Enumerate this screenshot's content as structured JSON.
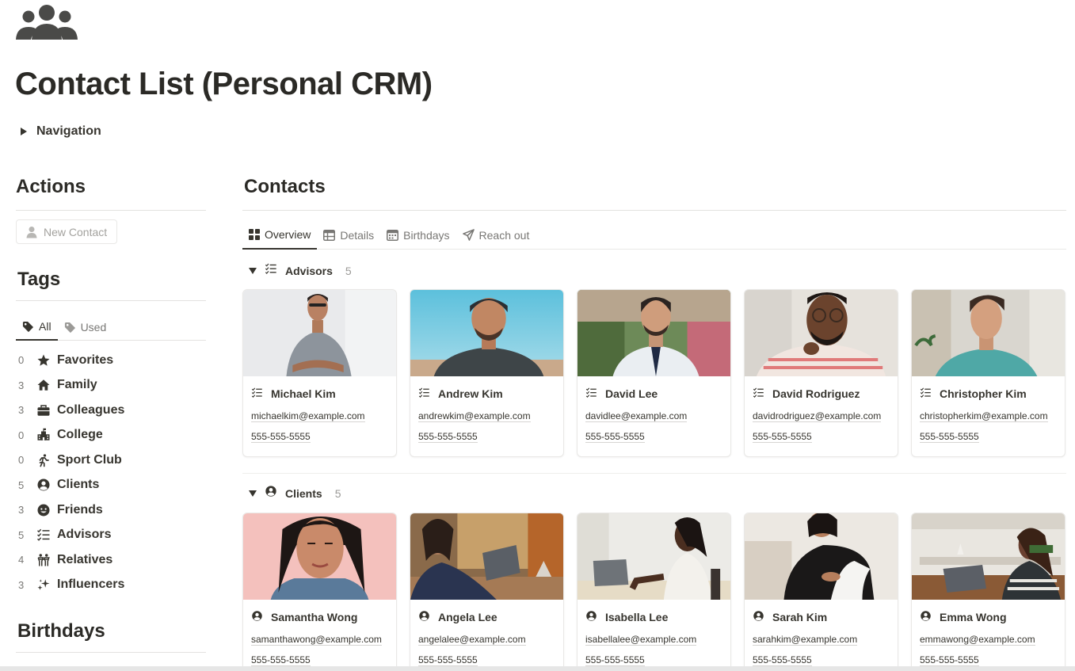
{
  "page": {
    "icon": "people-group-icon",
    "title": "Contact List (Personal CRM)",
    "navigation_toggle": "Navigation"
  },
  "actions": {
    "title": "Actions",
    "new_contact": "New Contact"
  },
  "tags": {
    "title": "Tags",
    "tabs": [
      {
        "label": "All",
        "icon": "tag-icon",
        "active": true
      },
      {
        "label": "Used",
        "icon": "tag-icon",
        "active": false
      }
    ],
    "items": [
      {
        "count": "0",
        "label": "Favorites",
        "icon": "star-icon"
      },
      {
        "count": "3",
        "label": "Family",
        "icon": "home-icon"
      },
      {
        "count": "3",
        "label": "Colleagues",
        "icon": "briefcase-icon"
      },
      {
        "count": "0",
        "label": "College",
        "icon": "school-icon"
      },
      {
        "count": "0",
        "label": "Sport Club",
        "icon": "running-icon"
      },
      {
        "count": "5",
        "label": "Clients",
        "icon": "user-circle-icon"
      },
      {
        "count": "3",
        "label": "Friends",
        "icon": "smile-icon"
      },
      {
        "count": "5",
        "label": "Advisors",
        "icon": "checklist-icon"
      },
      {
        "count": "4",
        "label": "Relatives",
        "icon": "people-icon"
      },
      {
        "count": "3",
        "label": "Influencers",
        "icon": "sparkles-icon"
      }
    ]
  },
  "birthdays": {
    "title": "Birthdays"
  },
  "contacts": {
    "title": "Contacts",
    "views": [
      {
        "label": "Overview",
        "icon": "gallery-icon",
        "active": true
      },
      {
        "label": "Details",
        "icon": "table-icon",
        "active": false
      },
      {
        "label": "Birthdays",
        "icon": "calendar-icon",
        "active": false
      },
      {
        "label": "Reach out",
        "icon": "send-icon",
        "active": false
      }
    ],
    "groups": [
      {
        "label": "Advisors",
        "icon": "checklist-icon",
        "count": "5",
        "cards": [
          {
            "name": "Michael Kim",
            "email": "michaelkim@example.com",
            "phone": "555-555-5555"
          },
          {
            "name": "Andrew Kim",
            "email": "andrewkim@example.com",
            "phone": "555-555-5555"
          },
          {
            "name": "David Lee",
            "email": "davidlee@example.com",
            "phone": "555-555-5555"
          },
          {
            "name": "David Rodriguez",
            "email": "davidrodriguez@example.com",
            "phone": "555-555-5555"
          },
          {
            "name": "Christopher Kim",
            "email": "christopherkim@example.com",
            "phone": "555-555-5555"
          }
        ]
      },
      {
        "label": "Clients",
        "icon": "user-circle-icon",
        "count": "5",
        "cards": [
          {
            "name": "Samantha Wong",
            "email": "samanthawong@example.com",
            "phone": "555-555-5555"
          },
          {
            "name": "Angela Lee",
            "email": "angelalee@example.com",
            "phone": "555-555-5555"
          },
          {
            "name": "Isabella Lee",
            "email": "isabellalee@example.com",
            "phone": "555-555-5555"
          },
          {
            "name": "Sarah Kim",
            "email": "sarahkim@example.com",
            "phone": "555-555-5555"
          },
          {
            "name": "Emma Wong",
            "email": "emmawong@example.com",
            "phone": "555-555-5555"
          }
        ]
      }
    ]
  }
}
